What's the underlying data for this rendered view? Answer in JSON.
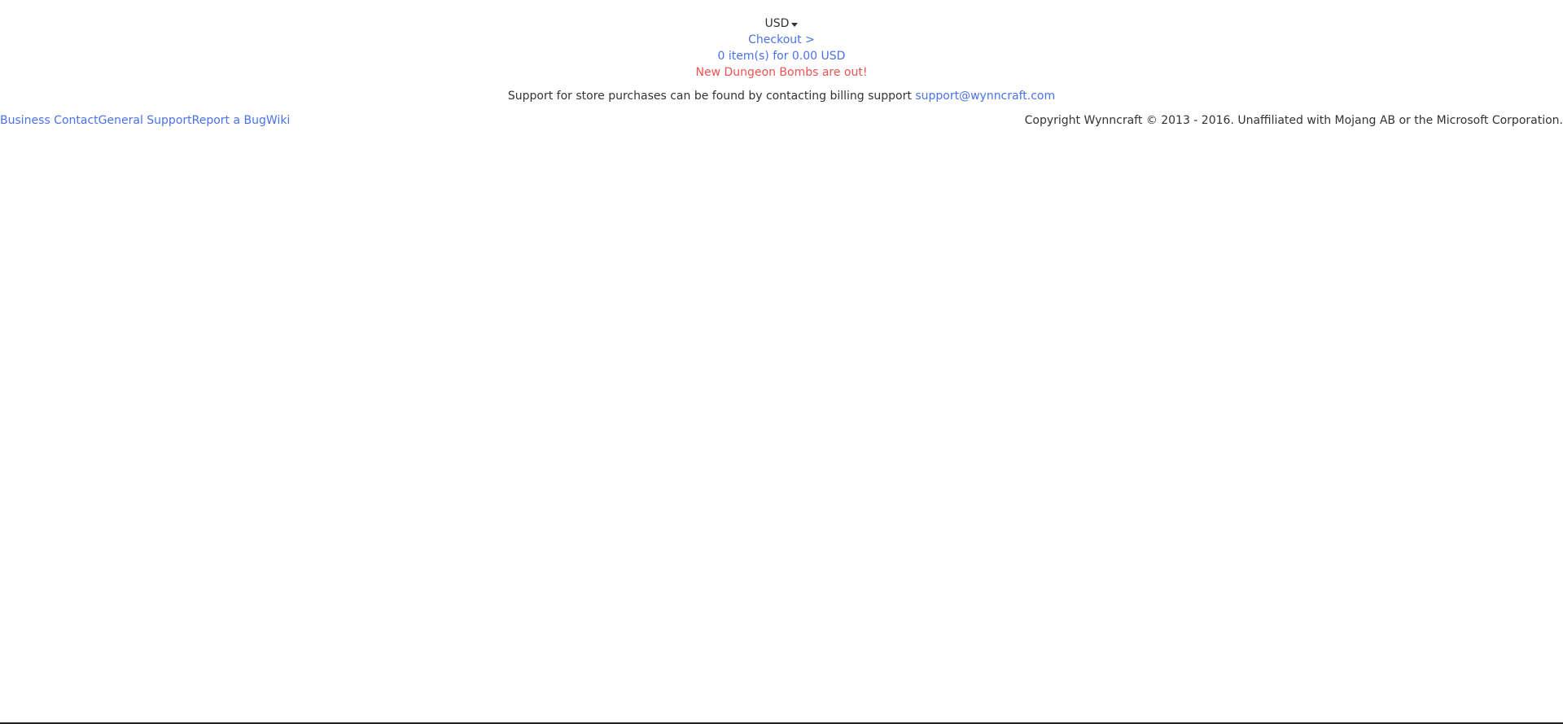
{
  "header": {
    "currency": "USD",
    "checkout_label": "Checkout >",
    "cart_summary": "0 item(s) for 0.00 USD",
    "announcement": "New Dungeon Bombs are out!"
  },
  "support": {
    "text": "Support for store purchases can be found by contacting billing support ",
    "email": "support@wynncraft.com"
  },
  "footer": {
    "links": [
      "Business Contact",
      "General Support",
      "Report a Bug",
      "Wiki"
    ],
    "copyright": "Copyright Wynncraft © 2013 - 2016. Unaffiliated with Mojang AB or the Microsoft Corporation."
  },
  "colors": {
    "link": "#4a72e8",
    "announcement": "#ef5350",
    "text": "#333333"
  }
}
